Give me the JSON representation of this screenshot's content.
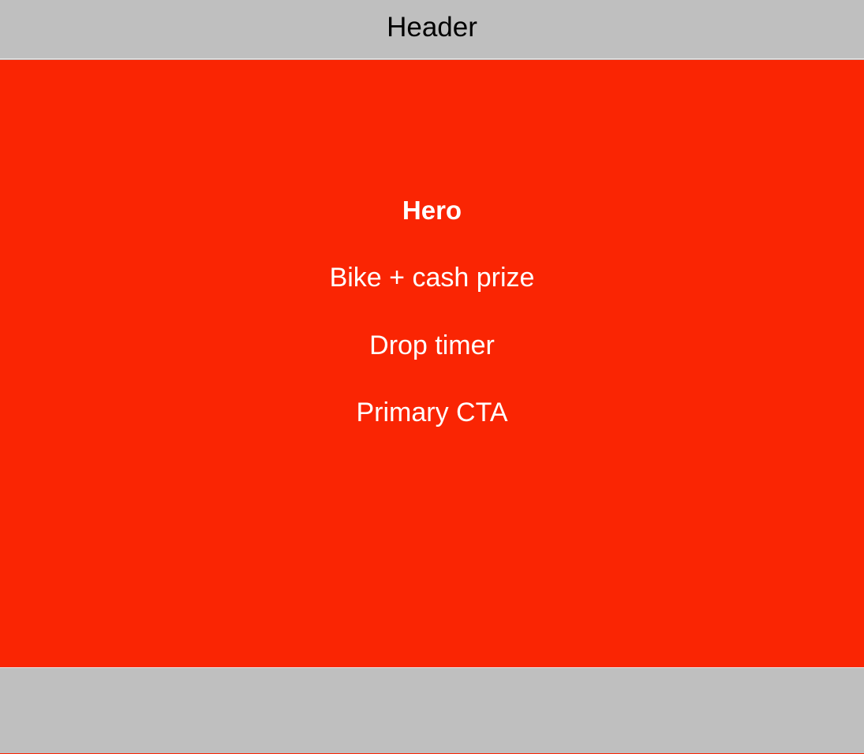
{
  "header": {
    "title": "Header"
  },
  "hero": {
    "title": "Hero",
    "prize": "Bike + cash prize",
    "timer": "Drop timer",
    "cta": "Primary CTA"
  },
  "colors": {
    "header_bg": "#bfbfbf",
    "hero_bg": "#fa2503",
    "hero_text": "#ffffff",
    "footer_bg": "#bfbfbf"
  }
}
